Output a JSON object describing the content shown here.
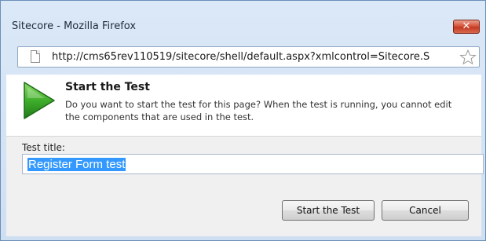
{
  "window": {
    "title": "Sitecore - Mozilla Firefox",
    "close_label": "✕"
  },
  "urlbar": {
    "url": "http://cms65rev110519/sitecore/shell/default.aspx?xmlcontrol=Sitecore.S"
  },
  "dialog": {
    "title": "Start the Test",
    "description": "Do you want to start the test for this page? When the test is running, you cannot edit the components that are used in the test.",
    "field_label": "Test title:",
    "field_value": "Register Form test",
    "buttons": {
      "start": "Start the Test",
      "cancel": "Cancel"
    }
  },
  "colors": {
    "play_icon": "#3aa92a",
    "close_button": "#c94a30",
    "selection": "#3399ff"
  }
}
